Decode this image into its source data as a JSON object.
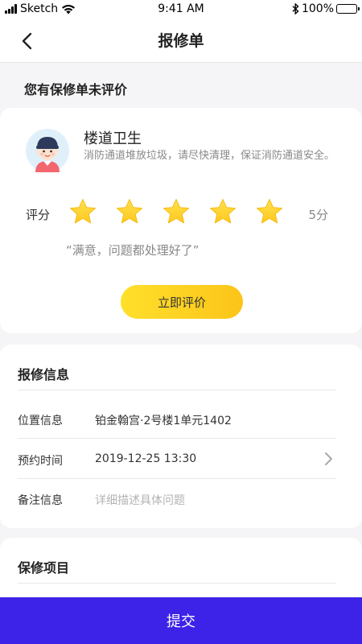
{
  "status_bar": {
    "carrier": "Sketch",
    "time": "9:41 AM",
    "battery": "100%",
    "battery_level": 1.0
  },
  "nav": {
    "title": "报修单",
    "back_icon": "chevron-left-icon"
  },
  "pending_hint": "您有保修单未评价",
  "evaluation": {
    "title": "楼道卫生",
    "description": "消防通道堆放垃圾，请尽快清理，保证消防通道安全。",
    "rating_label": "评分",
    "stars": 5,
    "rating_text": "5分",
    "quote": "“满意，问题都处理好了”",
    "button_label": "立即评价",
    "star_color": "#ffc820",
    "button_color": "#fcc419"
  },
  "repair_info": {
    "heading": "报修信息",
    "rows": [
      {
        "label": "位置信息",
        "value": "铂金翰宫·2号楼1单元1402"
      },
      {
        "label": "预约时间",
        "value": "2019-12-25  13:30"
      },
      {
        "label": "备注信息",
        "placeholder": "详细描述具体问题"
      }
    ]
  },
  "repair_items": {
    "heading": "保修项目"
  },
  "submit_label": "提交",
  "accent_color": "#3d22e8"
}
